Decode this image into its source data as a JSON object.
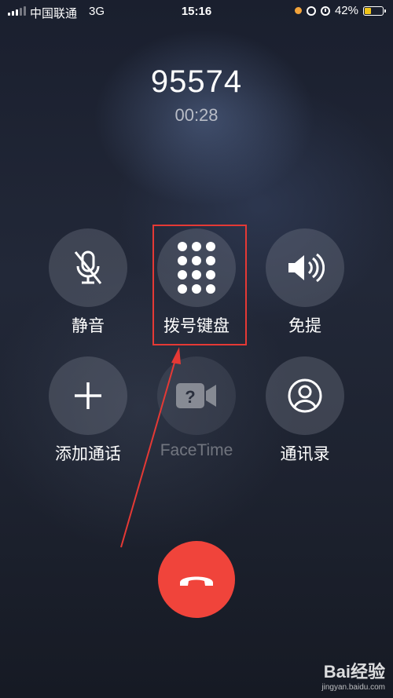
{
  "status_bar": {
    "carrier": "中国联通",
    "network": "3G",
    "time": "15:16",
    "battery_percent": "42%",
    "battery_level": 0.42,
    "battery_color": "#f0c419"
  },
  "call": {
    "number": "95574",
    "duration": "00:28"
  },
  "controls": {
    "mute": {
      "label": "静音",
      "icon": "mic-muted-icon"
    },
    "keypad": {
      "label": "拨号键盘",
      "icon": "keypad-icon",
      "highlighted": true
    },
    "speaker": {
      "label": "免提",
      "icon": "speaker-icon"
    },
    "add_call": {
      "label": "添加通话",
      "icon": "plus-icon"
    },
    "facetime": {
      "label": "FaceTime",
      "icon": "facetime-icon",
      "enabled": false
    },
    "contacts": {
      "label": "通讯录",
      "icon": "contact-icon"
    }
  },
  "end_call": {
    "icon": "end-call-icon",
    "color": "#f0443b"
  },
  "annotation": {
    "highlight_color": "#e53935",
    "arrow_color": "#e53935"
  },
  "watermark": {
    "brand": "Bai经验",
    "url": "jingyan.baidu.com"
  }
}
